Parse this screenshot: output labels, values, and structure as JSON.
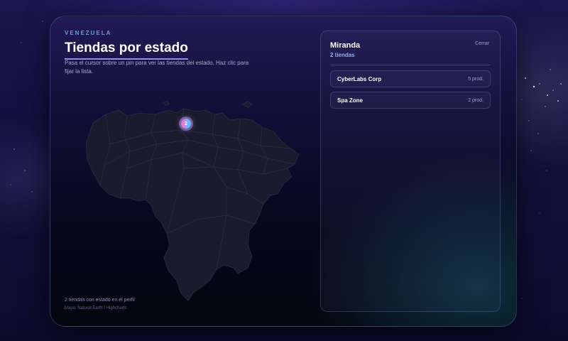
{
  "header": {
    "eyebrow": "VENEZUELA",
    "title": "Tiendas por estado",
    "hint": "Pasa el cursor sobre un pin para ver las tiendas del estado. Haz clic para fijar la lista."
  },
  "map": {
    "pin_count": "2",
    "summary": "2 tiendas con estado en el perfil",
    "source": "Mapa: Natural Earth / Highcharts"
  },
  "panel": {
    "state": "Miranda",
    "count": "2 tiendas",
    "close_label": "Cerrar",
    "stores": [
      {
        "name": "CyberLabs Corp",
        "count": "5 prod."
      },
      {
        "name": "Spa Zone",
        "count": "2 prod."
      }
    ]
  },
  "colors": {
    "accent": "#9c86f0",
    "eyebrow": "#6f9ad8",
    "panel_count": "#8fb4e8"
  }
}
